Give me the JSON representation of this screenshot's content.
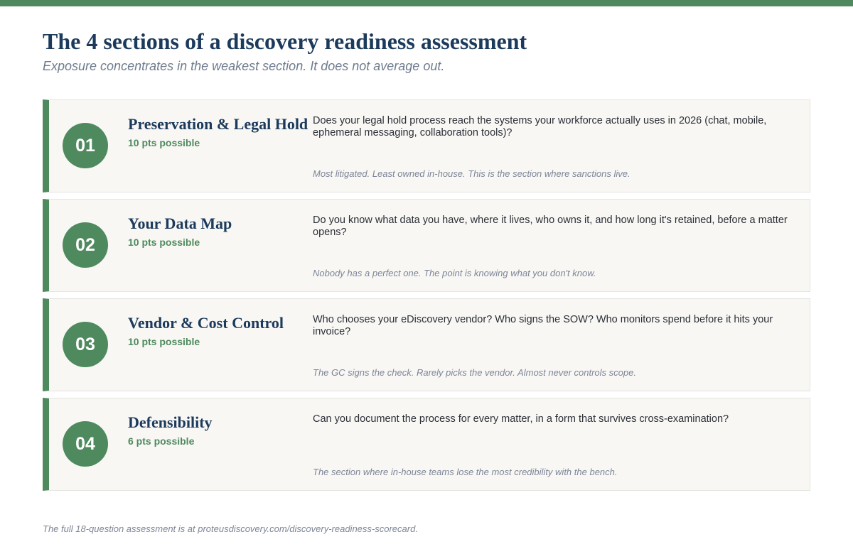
{
  "page": {
    "title": "The 4 sections of a discovery readiness assessment",
    "subtitle": "Exposure concentrates in the weakest section. It does not average out.",
    "footer": "The full 18-question assessment is at proteusdiscovery.com/discovery-readiness-scorecard.",
    "accent_color": "#4e8a5e",
    "heading_color": "#1c3a5c"
  },
  "sections": [
    {
      "number": "01",
      "name": "Preservation & Legal Hold",
      "points": "10 pts possible",
      "question": "Does your legal hold process reach the systems your workforce actually uses in 2026 (chat, mobile, ephemeral messaging, collaboration tools)?",
      "note": "Most litigated. Least owned in-house. This is the section where sanctions live."
    },
    {
      "number": "02",
      "name": "Your Data Map",
      "points": "10 pts possible",
      "question": "Do you know what data you have, where it lives, who owns it, and how long it's retained, before a matter opens?",
      "note": "Nobody has a perfect one. The point is knowing what you don't know."
    },
    {
      "number": "03",
      "name": "Vendor & Cost Control",
      "points": "10 pts possible",
      "question": "Who chooses your eDiscovery vendor? Who signs the SOW? Who monitors spend before it hits your invoice?",
      "note": "The GC signs the check. Rarely picks the vendor. Almost never controls scope."
    },
    {
      "number": "04",
      "name": "Defensibility",
      "points": "6 pts possible",
      "question": "Can you document the process for every matter, in a form that survives cross-examination?",
      "note": "The section where in-house teams lose the most credibility with the bench."
    }
  ]
}
